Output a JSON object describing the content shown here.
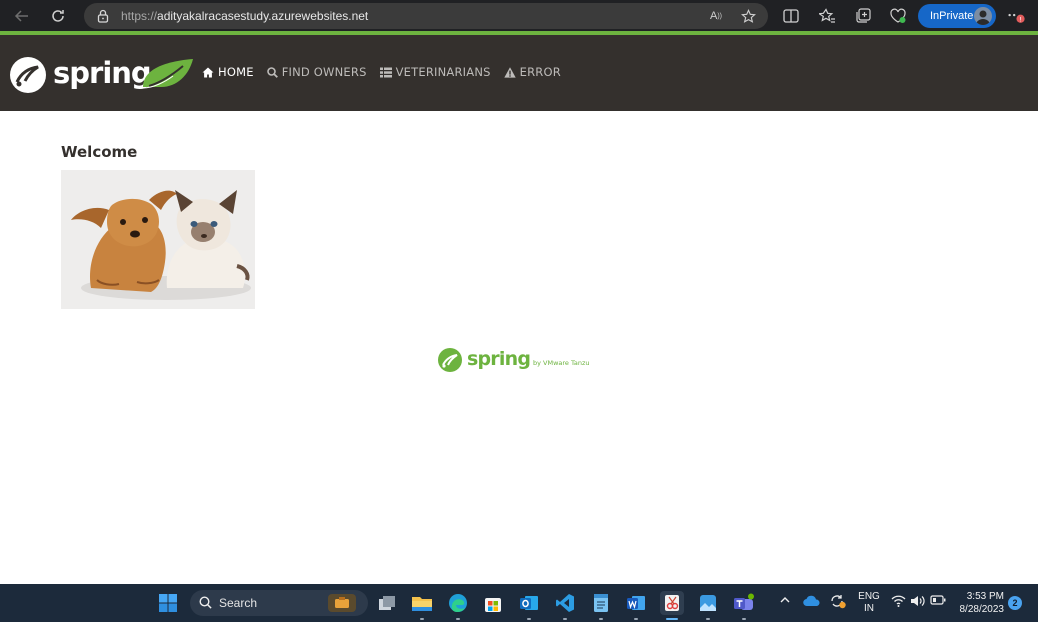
{
  "browser": {
    "url_protocol": "https://",
    "url_host": "adityakalracasestudy.azurewebsites.net",
    "inprivate_label": "InPrivate",
    "read_aloud_label": "A",
    "icons": [
      "back-icon",
      "refresh-icon",
      "lock-icon",
      "read-aloud-icon",
      "favorite-star-icon",
      "split-screen-icon",
      "favorites-icon",
      "collections-icon",
      "browser-essentials-icon",
      "more-icon"
    ]
  },
  "nav": {
    "brand": "spring",
    "items": [
      {
        "label": "HOME",
        "icon": "home-icon",
        "active": true
      },
      {
        "label": "FIND OWNERS",
        "icon": "search-icon",
        "active": false
      },
      {
        "label": "VETERINARIANS",
        "icon": "list-icon",
        "active": false
      },
      {
        "label": "ERROR",
        "icon": "warning-icon",
        "active": false
      }
    ]
  },
  "main": {
    "heading": "Welcome",
    "image": "pets-image"
  },
  "footer": {
    "brand": "spring",
    "tagline": "by VMware Tanzu"
  },
  "taskbar": {
    "search_label": "Search",
    "lang_top": "ENG",
    "lang_bottom": "IN",
    "time": "3:53 PM",
    "date": "8/28/2023",
    "notifications": "2"
  },
  "colors": {
    "spring_green": "#6db33f",
    "nav_bg": "#34302d",
    "inprivate_blue": "#1667c8"
  }
}
